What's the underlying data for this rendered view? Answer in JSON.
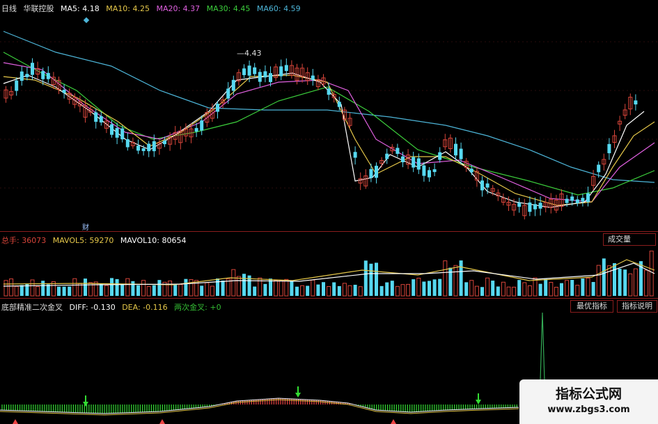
{
  "price_panel": {
    "period_label": "日线",
    "stock_name": "华联控股",
    "ma": [
      {
        "label": "MA5:",
        "value": "4.18",
        "color": "#ffffff"
      },
      {
        "label": "MA10:",
        "value": "4.25",
        "color": "#e6c84a"
      },
      {
        "label": "MA20:",
        "value": "4.37",
        "color": "#e060e0"
      },
      {
        "label": "MA30:",
        "value": "4.45",
        "color": "#3ccf3c"
      },
      {
        "label": "MA60:",
        "value": "4.59",
        "color": "#4db5d8"
      }
    ],
    "high_marker": "4.43",
    "finance_marker": "财"
  },
  "volume_panel": {
    "total_label": "总手:",
    "total_value": "36073",
    "mavol5_label": "MAVOL5:",
    "mavol5_value": "59270",
    "mavol10_label": "MAVOL10:",
    "mavol10_value": "80654",
    "dropdown_label": "成交量",
    "dropdown_arrow": "▼"
  },
  "indicator_panel": {
    "name": "底部精准二次金叉",
    "diff_label": "DIFF:",
    "diff_value": "-0.130",
    "dea_label": "DEA:",
    "dea_value": "-0.116",
    "cross_label": "两次金叉:",
    "cross_value": "+0",
    "best_button": "最优指标",
    "help_button": "指标说明"
  },
  "watermark": {
    "title": "指标公式网",
    "url": "www.zbgs3.com"
  },
  "colors": {
    "up": "#d8453a",
    "down": "#56d8f0",
    "border": "#8a1d1d",
    "green_signal": "#33dd33",
    "red_signal": "#ee4444"
  }
}
